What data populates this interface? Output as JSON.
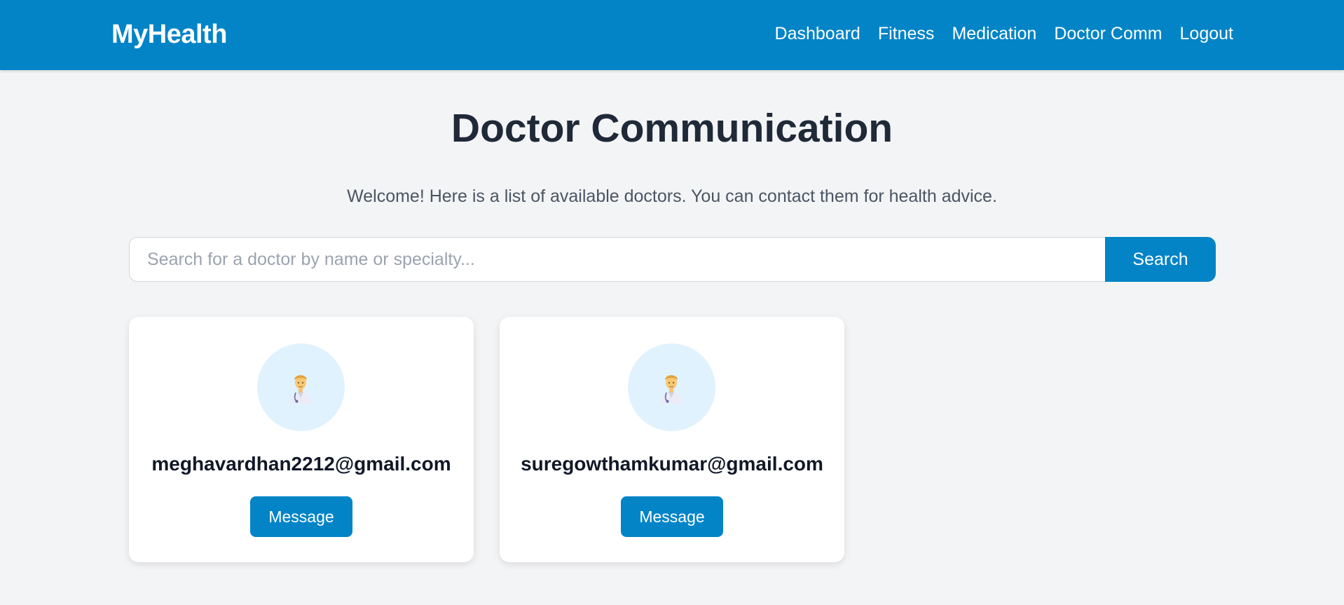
{
  "navbar": {
    "brand": "MyHealth",
    "links": [
      "Dashboard",
      "Fitness",
      "Medication",
      "Doctor Comm",
      "Logout"
    ]
  },
  "main": {
    "title": "Doctor Communication",
    "welcome": "Welcome! Here is a list of available doctors. You can contact them for health advice.",
    "search": {
      "placeholder": "Search for a doctor by name or specialty...",
      "value": "",
      "button_label": "Search"
    },
    "doctors": [
      {
        "email": "meghavardhan2212@gmail.com",
        "avatar_icon": "doctor-icon",
        "button_label": "Message"
      },
      {
        "email": "suregowthamkumar@gmail.com",
        "avatar_icon": "doctor-icon",
        "button_label": "Message"
      }
    ]
  },
  "colors": {
    "primary": "#0284c7",
    "background": "#f3f4f6",
    "avatar_bg": "#e0f2fe",
    "heading": "#1f2937"
  }
}
